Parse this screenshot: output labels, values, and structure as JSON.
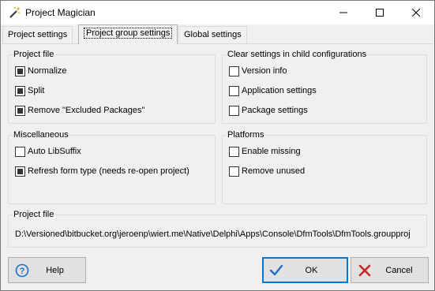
{
  "window": {
    "title": "Project Magician"
  },
  "titlebar": {
    "minimize_icon": "minimize-icon",
    "maximize_icon": "maximize-icon",
    "close_icon": "close-icon"
  },
  "tabs": [
    {
      "label": "Project settings",
      "active": false
    },
    {
      "label": "Project group settings",
      "active": true
    },
    {
      "label": "Global settings",
      "active": false
    }
  ],
  "project_file_group": {
    "title": "Project file",
    "options": [
      {
        "label": "Normalize",
        "checked": true
      },
      {
        "label": "Split",
        "checked": true
      },
      {
        "label": "Remove \"Excluded Packages\"",
        "checked": true
      }
    ]
  },
  "clear_settings_group": {
    "title": "Clear settings in child configurations",
    "options": [
      {
        "label": "Version info",
        "checked": false
      },
      {
        "label": "Application settings",
        "checked": false
      },
      {
        "label": "Package settings",
        "checked": false
      }
    ]
  },
  "misc_group": {
    "title": "Miscellaneous",
    "options": [
      {
        "label": "Auto LibSuffix",
        "checked": false
      },
      {
        "label": "Refresh form type (needs re-open project)",
        "checked": true
      }
    ]
  },
  "platforms_group": {
    "title": "Platforms",
    "options": [
      {
        "label": "Enable missing",
        "checked": false
      },
      {
        "label": "Remove unused",
        "checked": false
      }
    ]
  },
  "project_path_group": {
    "title": "Project file",
    "path": "D:\\Versioned\\bitbucket.org\\jeroenp\\wiert.me\\Native\\Delphi\\Apps\\Console\\DfmTools\\DfmTools.groupproj"
  },
  "buttons": {
    "help": "Help",
    "ok": "OK",
    "cancel": "Cancel"
  },
  "colors": {
    "accent": "#0078d7",
    "help_icon": "#1f6fc2",
    "ok_icon": "#1f6fc2",
    "cancel_icon": "#c62828"
  }
}
